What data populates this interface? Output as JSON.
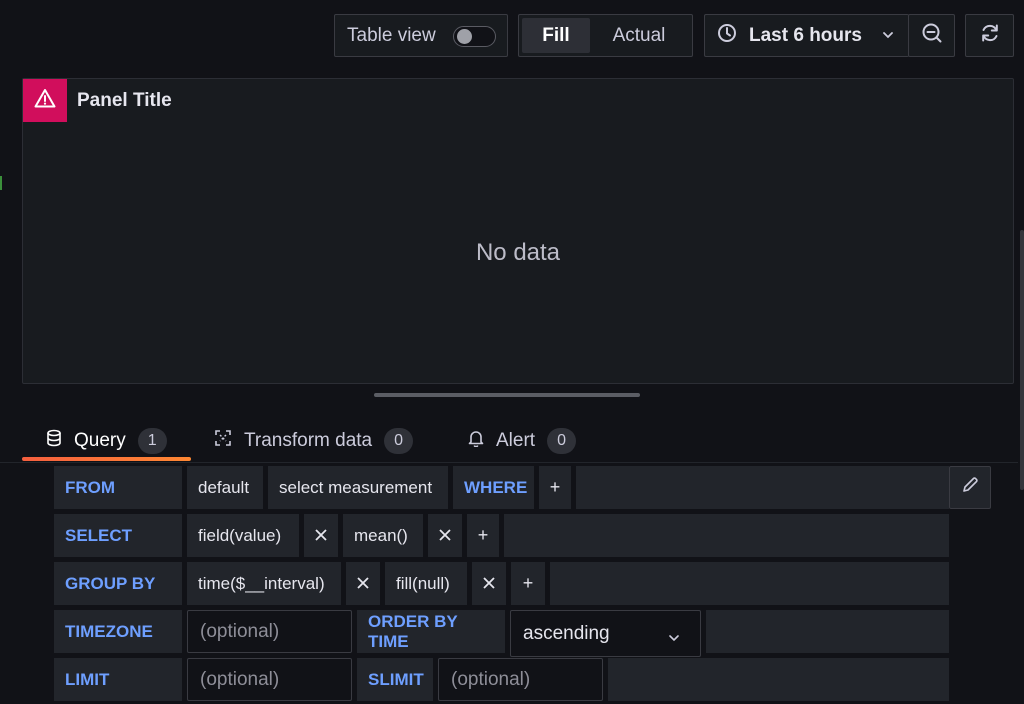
{
  "toolbar": {
    "table_view_label": "Table view",
    "table_view_on": false,
    "fill_label": "Fill",
    "actual_label": "Actual",
    "time_range_label": "Last 6 hours",
    "icons": {
      "clock": "clock-icon",
      "chevron": "chevron-down-icon",
      "zoom_out": "zoom-out-icon",
      "refresh": "refresh-icon"
    }
  },
  "panel": {
    "title": "Panel Title",
    "empty_message": "No data",
    "warning_color": "#d10e5c"
  },
  "tabs": [
    {
      "label": "Query",
      "count": "1",
      "icon": "database-icon",
      "active": true
    },
    {
      "label": "Transform data",
      "count": "0",
      "icon": "transform-icon",
      "active": false
    },
    {
      "label": "Alert",
      "count": "0",
      "icon": "bell-icon",
      "active": false
    }
  ],
  "query": {
    "from": {
      "keyword": "FROM",
      "policy": "default",
      "measurement": "select measurement",
      "where_keyword": "WHERE",
      "add": "+"
    },
    "select": {
      "keyword": "SELECT",
      "field": "field(value)",
      "func": "mean()",
      "add": "+"
    },
    "group_by": {
      "keyword": "GROUP BY",
      "time": "time($__interval)",
      "fill": "fill(null)",
      "add": "+"
    },
    "timezone": {
      "keyword": "TIMEZONE",
      "placeholder": "(optional)",
      "order_keyword": "ORDER BY TIME",
      "order_value": "ascending"
    },
    "limit": {
      "keyword": "LIMIT",
      "placeholder": "(optional)",
      "slimit_keyword": "SLIMIT",
      "slimit_placeholder": "(optional)"
    }
  },
  "colors": {
    "accent": "#6e9fff",
    "tab_underline": "#f55f3e",
    "background": "#111217",
    "panel": "#181b1f"
  }
}
